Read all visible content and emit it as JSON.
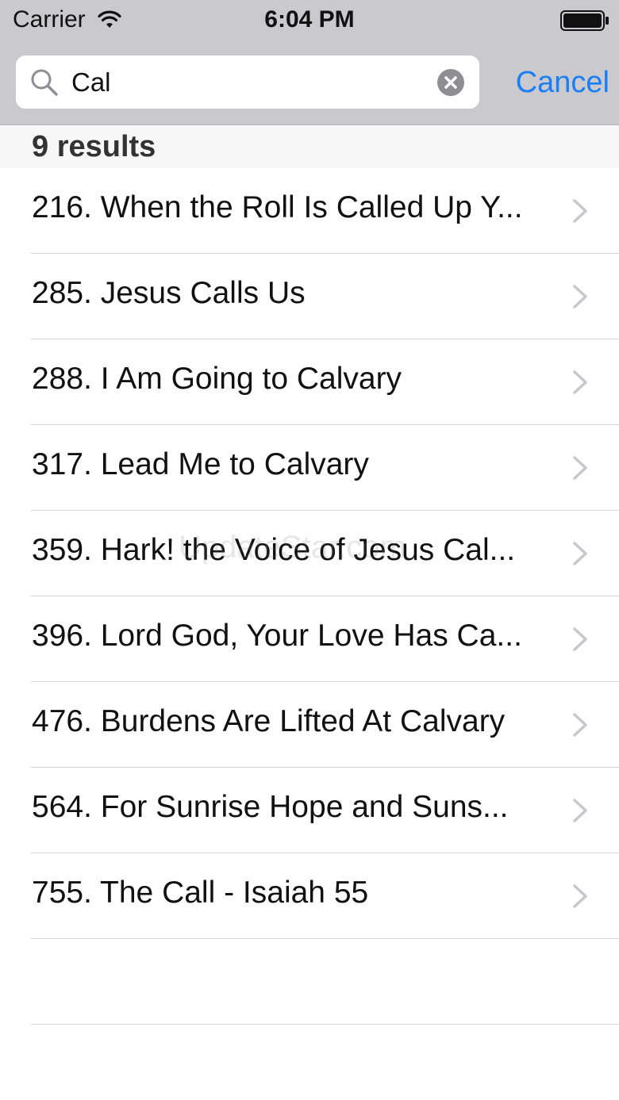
{
  "status_bar": {
    "carrier": "Carrier",
    "time": "6:04 PM",
    "icons": [
      "wifi-icon",
      "battery-icon"
    ]
  },
  "search": {
    "value": "Cal",
    "cancel_label": "Cancel",
    "icons": [
      "search-icon",
      "clear-icon"
    ]
  },
  "results": {
    "header": "9 results",
    "items": [
      {
        "label": "216. When the Roll Is Called Up Y..."
      },
      {
        "label": "285. Jesus Calls Us"
      },
      {
        "label": "288. I Am Going to Calvary"
      },
      {
        "label": "317. Lead Me to Calvary"
      },
      {
        "label": "359. Hark! the Voice of Jesus Cal..."
      },
      {
        "label": "396. Lord God, Your Love Has Ca..."
      },
      {
        "label": "476. Burdens Are Lifted At Calvary"
      },
      {
        "label": "564. For Sunrise Hope and Suns..."
      },
      {
        "label": "755. The Call - Isaiah 55"
      }
    ]
  },
  "watermark": "UpdateStar.com",
  "colors": {
    "accent": "#1a7ff5",
    "search_bar_bg": "#c9c9ce",
    "separator": "#d4d4d8"
  }
}
